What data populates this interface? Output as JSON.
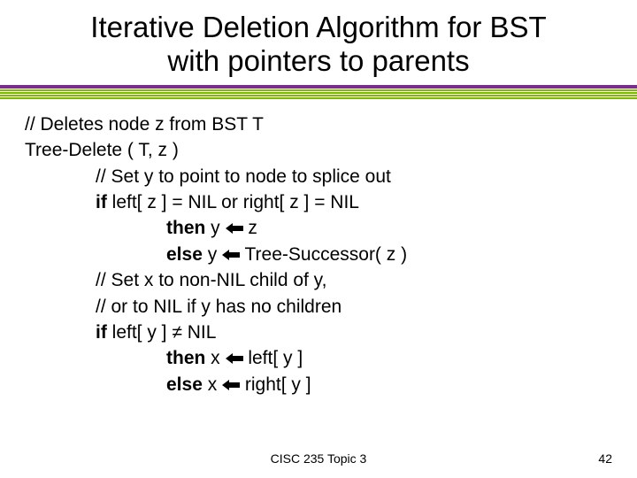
{
  "title_line1": "Iterative Deletion Algorithm for BST",
  "title_line2": "with pointers to parents",
  "lines": {
    "l0": "// Deletes node z from BST T",
    "l1": "Tree-Delete ( T, z )",
    "l2": "// Set y to point to node to splice out",
    "l3_a": "if",
    "l3_b": " left[ z ] = NIL or right[ z ] = NIL",
    "l4_a": "then",
    "l4_b": " y ",
    "l4_c": " z",
    "l5_a": "else",
    "l5_b": " y ",
    "l5_c": " Tree-Successor( z )",
    "l6": "// Set x to non-NIL child of y,",
    "l7": "// or to NIL if y has no children",
    "l8_a": "if",
    "l8_b": " left[ y ] ",
    "l8_c": " NIL",
    "l9_a": "then",
    "l9_b": " x ",
    "l9_c": " left[ y ]",
    "l10_a": "else",
    "l10_b": " x ",
    "l10_c": " right[ y ]"
  },
  "symbols": {
    "neq": "≠"
  },
  "footer": {
    "center": "CISC 235 Topic 3",
    "page": "42"
  }
}
